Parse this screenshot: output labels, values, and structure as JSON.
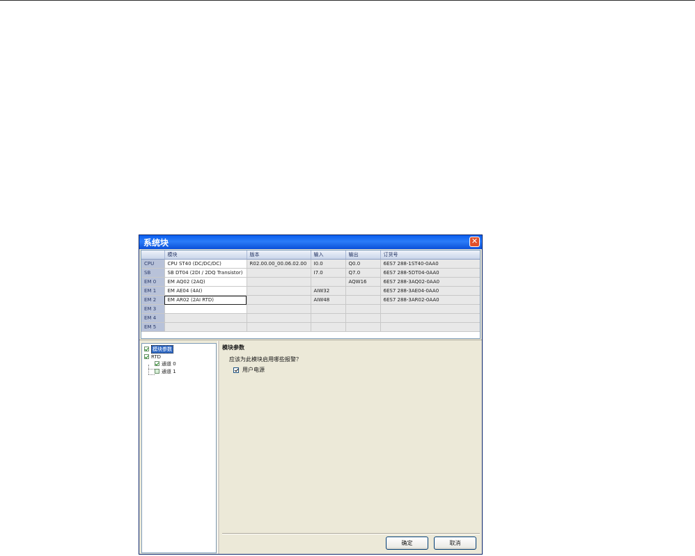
{
  "dialog": {
    "title": "系统块",
    "close_glyph": "✕"
  },
  "grid": {
    "headers": [
      "",
      "模块",
      "版本",
      "输入",
      "输出",
      "订货号"
    ],
    "rows": [
      {
        "slot": "CPU",
        "module": "CPU ST40 (DC/DC/DC)",
        "version": "R02.00.00_00.06.02.00",
        "input": "I0.0",
        "output": "Q0.0",
        "order": "6ES7 288-1ST40-0AA0"
      },
      {
        "slot": "SB",
        "module": "SB DT04 (2DI / 2DQ Transistor)",
        "version": "",
        "input": "I7.0",
        "output": "Q7.0",
        "order": "6ES7 288-5DT04-0AA0"
      },
      {
        "slot": "EM 0",
        "module": "EM AQ02 (2AQ)",
        "version": "",
        "input": "",
        "output": "AQW16",
        "order": "6ES7 288-3AQ02-0AA0"
      },
      {
        "slot": "EM 1",
        "module": "EM AE04 (4AI)",
        "version": "",
        "input": "AIW32",
        "output": "",
        "order": "6ES7 288-3AE04-0AA0"
      },
      {
        "slot": "EM 2",
        "module": "EM AR02 (2AI RTD)",
        "version": "",
        "input": "AIW48",
        "output": "",
        "order": "6ES7 288-3AR02-0AA0"
      },
      {
        "slot": "EM 3",
        "module": "",
        "version": "",
        "input": "",
        "output": "",
        "order": ""
      },
      {
        "slot": "EM 4",
        "module": "",
        "version": "",
        "input": "",
        "output": "",
        "order": ""
      },
      {
        "slot": "EM 5",
        "module": "",
        "version": "",
        "input": "",
        "output": "",
        "order": ""
      }
    ]
  },
  "tree": {
    "root": "模块参数",
    "group": "RTD",
    "channels": [
      "通道 0",
      "通道 1"
    ]
  },
  "params": {
    "title": "模块参数",
    "question": "应该为此模块启用哪些报警？",
    "option_label": "用户电源",
    "option_checked": true
  },
  "buttons": {
    "ok": "确定",
    "cancel": "取消"
  },
  "colors": {
    "titlebar": "#0a5ef0",
    "selection": "#316ac5",
    "dialog_bg": "#ece9d8"
  }
}
